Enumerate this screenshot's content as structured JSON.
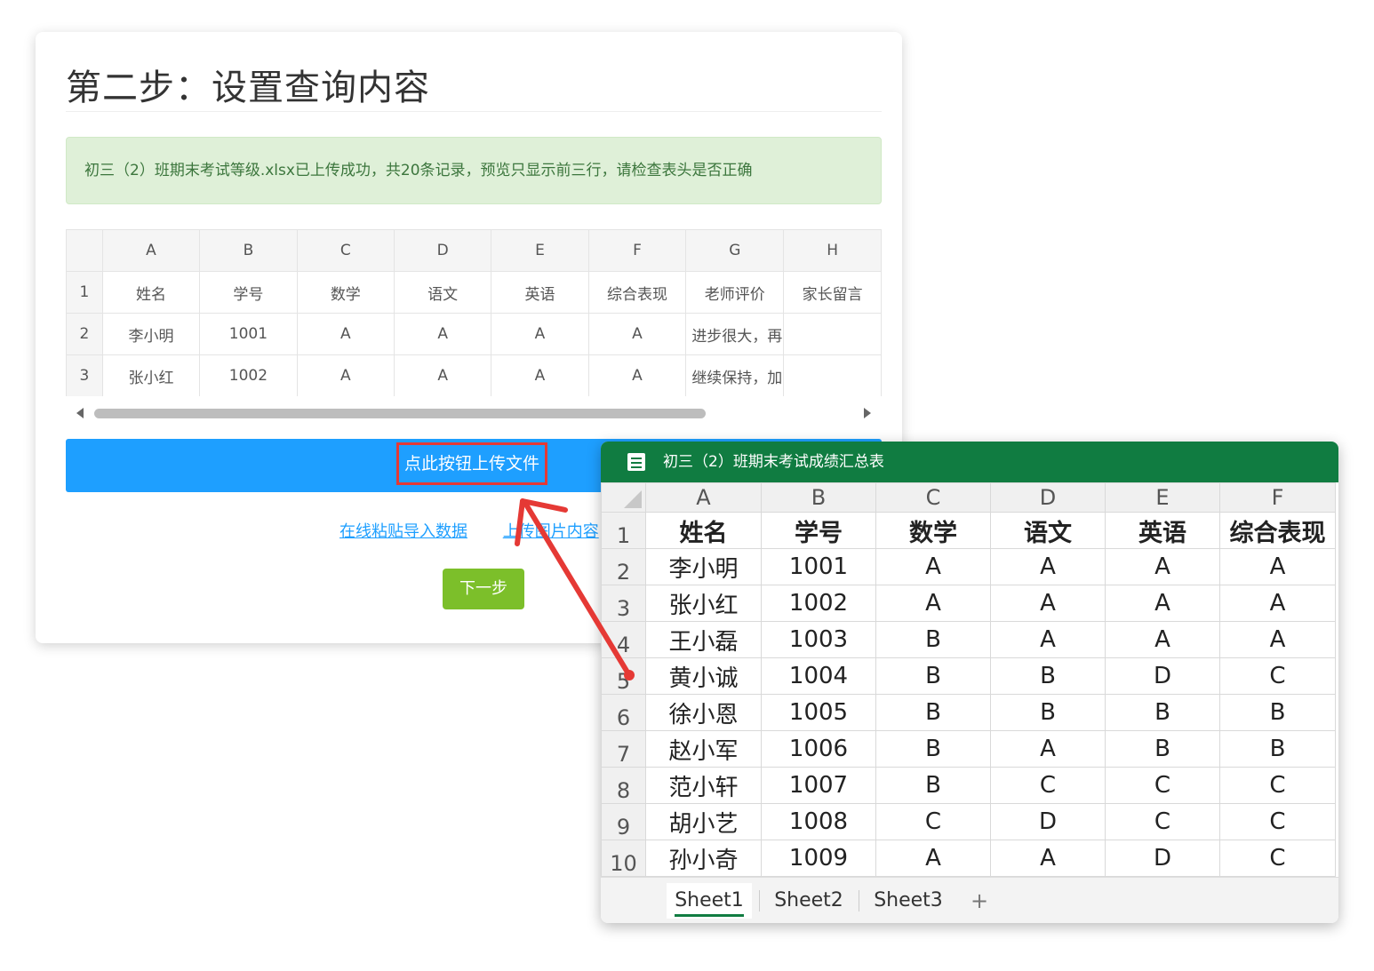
{
  "card": {
    "title": "第二步：设置查询内容",
    "alert": "初三（2）班期末考试等级.xlsx已上传成功，共20条记录，预览只显示前三行，请检查表头是否正确",
    "preview_columns": [
      "",
      "A",
      "B",
      "C",
      "D",
      "E",
      "F",
      "G",
      "H"
    ],
    "preview_rows": [
      [
        "1",
        "姓名",
        "学号",
        "数学",
        "语文",
        "英语",
        "综合表现",
        "老师评价",
        "家长留言"
      ],
      [
        "2",
        "李小明",
        "1001",
        "A",
        "A",
        "A",
        "A",
        "进步很大，再",
        ""
      ],
      [
        "3",
        "张小红",
        "1002",
        "A",
        "A",
        "A",
        "A",
        "继续保持，加",
        ""
      ]
    ],
    "upload_button": "点此按钮上传文件",
    "link_paste": "在线粘贴导入数据",
    "link_image": "上传图片内容",
    "next_button": "下一步"
  },
  "spreadsheet": {
    "title": "初三（2）班期末考试成绩汇总表",
    "columns": [
      "A",
      "B",
      "C",
      "D",
      "E",
      "F"
    ],
    "rows": [
      [
        "1",
        "姓名",
        "学号",
        "数学",
        "语文",
        "英语",
        "综合表现"
      ],
      [
        "2",
        "李小明",
        "1001",
        "A",
        "A",
        "A",
        "A"
      ],
      [
        "3",
        "张小红",
        "1002",
        "A",
        "A",
        "A",
        "A"
      ],
      [
        "4",
        "王小磊",
        "1003",
        "B",
        "A",
        "A",
        "A"
      ],
      [
        "5",
        "黄小诚",
        "1004",
        "B",
        "B",
        "D",
        "C"
      ],
      [
        "6",
        "徐小恩",
        "1005",
        "B",
        "B",
        "B",
        "B"
      ],
      [
        "7",
        "赵小军",
        "1006",
        "B",
        "A",
        "B",
        "B"
      ],
      [
        "8",
        "范小轩",
        "1007",
        "B",
        "C",
        "C",
        "C"
      ],
      [
        "9",
        "胡小艺",
        "1008",
        "C",
        "D",
        "C",
        "C"
      ],
      [
        "10",
        "孙小奇",
        "1009",
        "A",
        "A",
        "D",
        "C"
      ]
    ],
    "sheet_tabs": [
      "Sheet1",
      "Sheet2",
      "Sheet3"
    ],
    "add_tab": "+"
  },
  "colors": {
    "upload_bar": "#1e9fff",
    "highlight_border": "#e53935",
    "next_button": "#7cbf2a",
    "spreadsheet_header": "#107c41",
    "alert_bg": "#dff0d8",
    "arrow": "#e53935"
  }
}
